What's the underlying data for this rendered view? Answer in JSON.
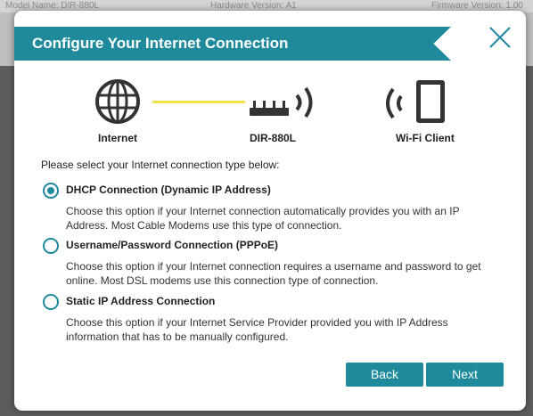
{
  "background": {
    "model_name": "Model Name: DIR-880L",
    "hardware_version": "Hardware Version: A1",
    "firmware_version": "Firmware Version: 1.00"
  },
  "dialog": {
    "title": "Configure Your Internet Connection",
    "close_icon": "close-icon",
    "diagram": {
      "internet_label": "Internet",
      "router_label": "DIR-880L",
      "client_label": "Wi-Fi Client"
    },
    "prompt": "Please select your Internet connection type below:",
    "options": [
      {
        "label": "DHCP Connection (Dynamic IP Address)",
        "description": "Choose this option if your Internet connection automatically provides you with an IP Address. Most Cable Modems use this type of connection.",
        "selected": true
      },
      {
        "label": "Username/Password Connection (PPPoE)",
        "description": "Choose this option if your Internet connection requires a username and password to get online. Most DSL modems use this connection type of connection.",
        "selected": false
      },
      {
        "label": "Static IP Address Connection",
        "description": "Choose this option if your Internet Service Provider provided you with IP Address information that has to be manually configured.",
        "selected": false
      }
    ],
    "buttons": {
      "back": "Back",
      "next": "Next"
    }
  },
  "colors": {
    "accent": "#1f8a9c",
    "link_line": "#f3e34a",
    "icon": "#333333"
  }
}
